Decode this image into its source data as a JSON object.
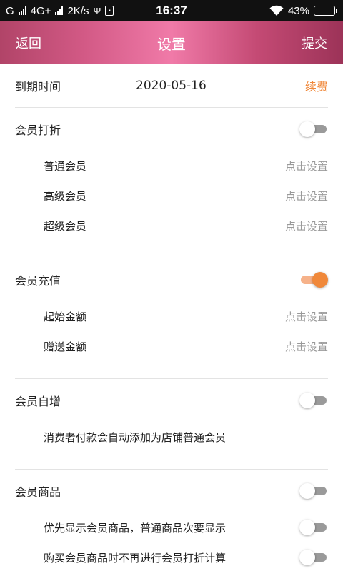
{
  "status_bar": {
    "carrier": "G",
    "network": "4G+",
    "speed": "2K/s",
    "time": "16:37",
    "battery": "43%",
    "battery_level": 0.43
  },
  "nav": {
    "back_label": "返回",
    "title": "设置",
    "submit_label": "提交"
  },
  "expiry": {
    "label": "到期时间",
    "date": "2020-05-16",
    "renew_label": "续费"
  },
  "discount": {
    "label": "会员打折",
    "enabled": false,
    "items": [
      {
        "label": "普通会员",
        "action": "点击设置"
      },
      {
        "label": "高级会员",
        "action": "点击设置"
      },
      {
        "label": "超级会员",
        "action": "点击设置"
      }
    ]
  },
  "recharge": {
    "label": "会员充值",
    "enabled": true,
    "items": [
      {
        "label": "起始金额",
        "action": "点击设置"
      },
      {
        "label": "赠送金额",
        "action": "点击设置"
      }
    ]
  },
  "auto_join": {
    "label": "会员自增",
    "enabled": false,
    "description": "消费者付款会自动添加为店铺普通会员"
  },
  "goods": {
    "label": "会员商品",
    "enabled": false,
    "options": [
      {
        "label": "优先显示会员商品，普通商品次要显示",
        "enabled": false
      },
      {
        "label": "购买会员商品时不再进行会员打折计算",
        "enabled": false
      }
    ]
  },
  "colors": {
    "accent": "#f0883a",
    "nav_gradient_center": "#f07aa8",
    "toggle_off": "#9a9a9a"
  }
}
